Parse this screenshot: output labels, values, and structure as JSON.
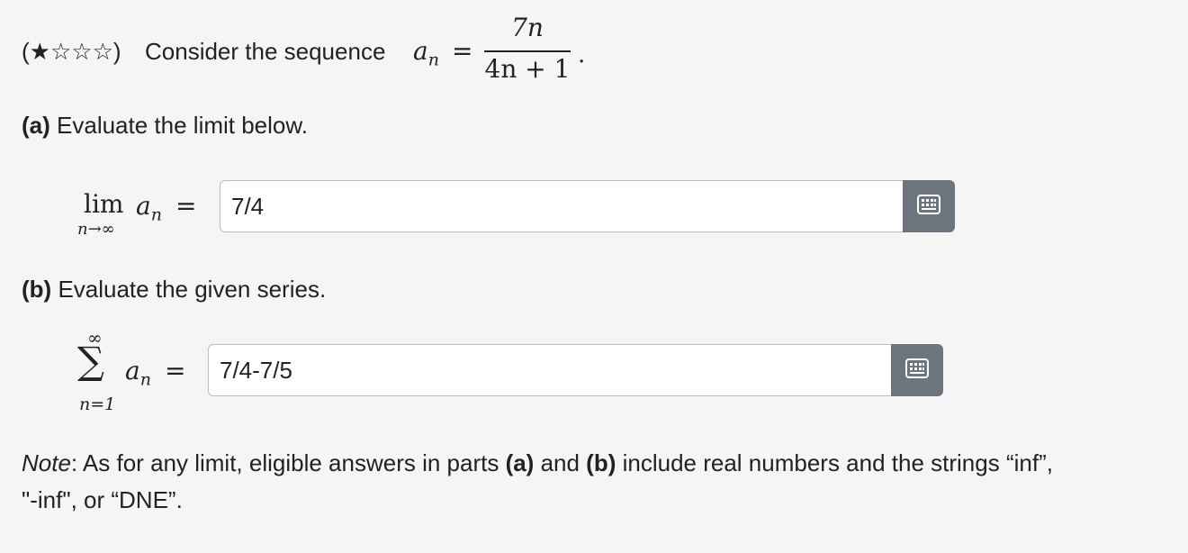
{
  "problem": {
    "difficulty_open": "(",
    "difficulty_stars": "★☆☆☆",
    "difficulty_close": ")",
    "intro": "Consider the sequence",
    "seq_var": "a",
    "seq_sub": "n",
    "equals": "=",
    "numerator": "7n",
    "denominator": "4n + 1",
    "period": "."
  },
  "part_a": {
    "label": "(a)",
    "prompt": "Evaluate the limit below.",
    "lim_word": "lim",
    "lim_sub": "n→∞",
    "var": "a",
    "sub": "n",
    "equals": "=",
    "answer": "7/4"
  },
  "part_b": {
    "label": "(b)",
    "prompt": "Evaluate the given series.",
    "sum_symbol": "∑",
    "sum_top": "∞",
    "sum_bottom": "n=1",
    "var": "a",
    "sub": "n",
    "equals": "=",
    "answer": "7/4-7/5"
  },
  "note": {
    "label": "Note",
    "text1": ": As for any limit, eligible answers in parts ",
    "a": "(a)",
    "and": " and ",
    "b": "(b)",
    "text2": " include real numbers and the strings “inf”,",
    "line2": "\"-inf\", or “DNE”."
  },
  "icons": {
    "keyboard": "keyboard-icon"
  },
  "colors": {
    "button_bg": "#6c757d",
    "page_bg": "#f5f5f5"
  }
}
